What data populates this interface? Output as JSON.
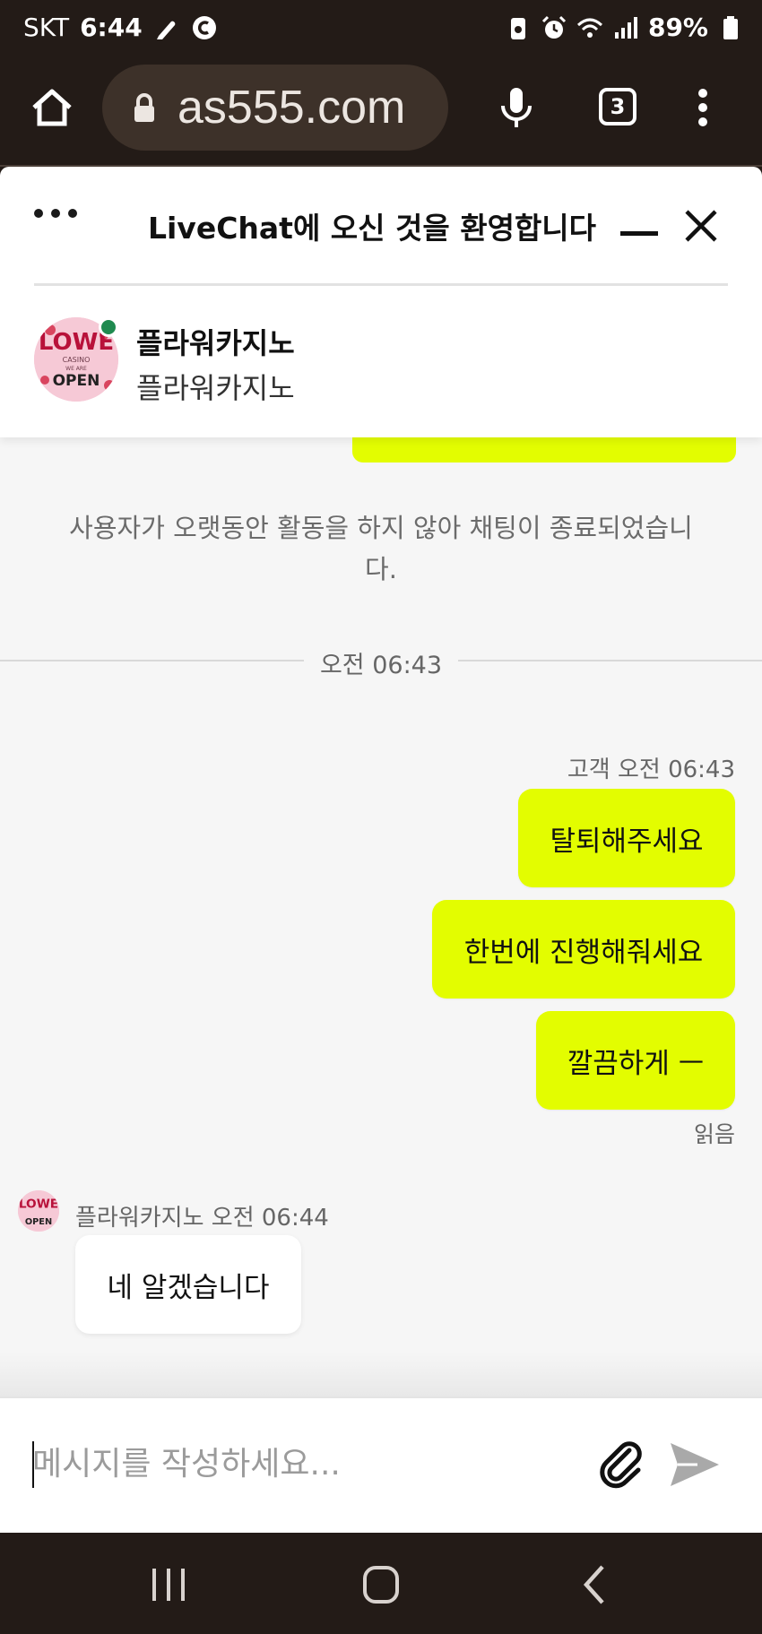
{
  "status_bar": {
    "carrier": "SKT",
    "time": "6:44",
    "battery": "89%",
    "icons": [
      "pencil-icon",
      "c-circle-icon",
      "battery-saver-icon",
      "alarm-icon",
      "wifi-icon",
      "signal-icon",
      "battery-icon"
    ]
  },
  "browser": {
    "url": "as555.com",
    "tab_count": "3",
    "icons": [
      "home-icon",
      "lock-icon",
      "microphone-icon",
      "tabs-icon",
      "more-vertical-icon"
    ]
  },
  "chat": {
    "title": "LiveChat에 오신 것을 환영합니다",
    "agent_name": "플라워카지노",
    "agent_subtitle": "플라워카지노",
    "agent_status_color": "#1f8a4f",
    "avatar_text": {
      "top": "LOWE",
      "mid1": "CASINO",
      "mid2": "WE ARE",
      "bottom": "OPEN"
    }
  },
  "messages": {
    "system_message": "사용자가 오랫동안 활동을 하지 않아 채팅이 종료되었습니다.",
    "time_separator": "오전 06:43",
    "customer_meta": "고객 오전 06:43",
    "outgoing": [
      {
        "text": "탈퇴해주세요"
      },
      {
        "text": "한번에 진행해줘세요"
      },
      {
        "text": "깔끔하게 ㅡ"
      }
    ],
    "read_label": "읽음",
    "agent_meta": "플라워카지노 오전 06:44",
    "incoming": [
      {
        "text": "네 알겠습니다"
      }
    ]
  },
  "composer": {
    "placeholder": "메시지를 작성하세요...",
    "accent_color": "#e3fd00"
  },
  "navbar": {
    "icons": [
      "recent-apps-icon",
      "home-nav-icon",
      "back-icon"
    ]
  }
}
